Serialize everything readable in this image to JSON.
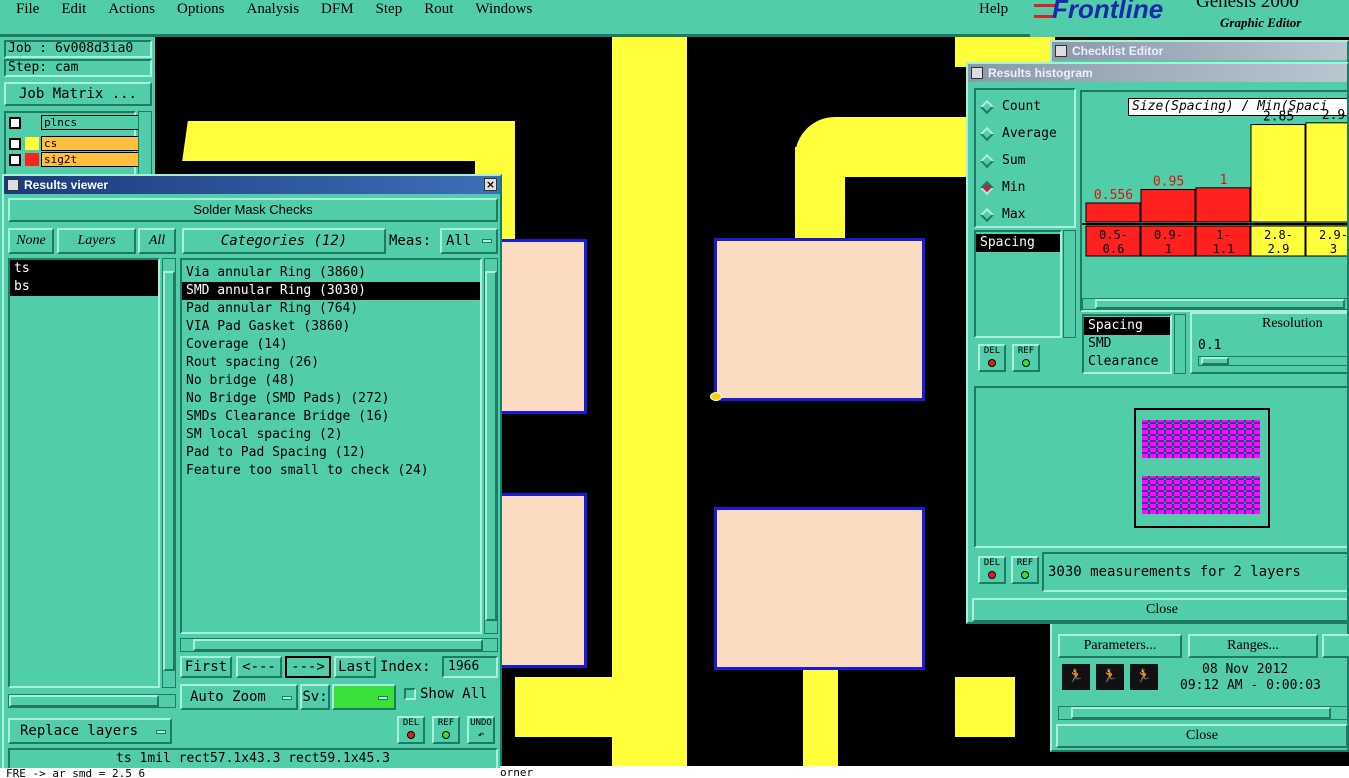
{
  "menubar": {
    "items": [
      "File",
      "Edit",
      "Actions",
      "Options",
      "Analysis",
      "DFM",
      "Step",
      "Rout",
      "Windows"
    ],
    "help": "Help"
  },
  "brand": {
    "logo": "Frontline",
    "product": "Genesis 2000",
    "subtitle": "Graphic Editor"
  },
  "job_panel": {
    "job": "Job : 6v008d3ia0",
    "step": "Step: cam",
    "job_matrix": "Job Matrix ...",
    "layers": [
      "plncs",
      "cs",
      "sig2t"
    ]
  },
  "results_viewer": {
    "title": "Results viewer",
    "heading": "Solder Mask Checks",
    "none_btn": "None",
    "layers_btn": "Layers",
    "all_btn": "All",
    "layer_list": [
      "ts",
      "bs"
    ],
    "categories_label": "Categories (12)",
    "meas_label": "Meas:",
    "meas_value": "All",
    "categories": [
      "Via annular Ring (3860)",
      "SMD annular Ring (3030)",
      "Pad annular Ring (764)",
      "VIA Pad Gasket (3860)",
      "Coverage (14)",
      "Rout spacing (26)",
      "No bridge (48)",
      "No Bridge (SMD Pads) (272)",
      "SMDs Clearance Bridge (16)",
      "SM local spacing (2)",
      "Pad to Pad Spacing (12)",
      "Feature too small to check (24)"
    ],
    "selected_index": 1,
    "first": "First",
    "prev": "<---",
    "next": "--->",
    "last": "Last",
    "index_label": "Index:",
    "index_value": "1966",
    "auto_zoom": "Auto Zoom",
    "sv_label": "Sv:",
    "show_all": "Show All",
    "replace_layers": "Replace layers",
    "del": "DEL",
    "ref": "REF",
    "undo": "UNDO",
    "status": "ts 1mil  rect57.1x43.3  rect59.1x45.3"
  },
  "command_line": "FRE -> ar_smd = 2.5 6",
  "canvas_footer": "orner",
  "checklist_editor": {
    "title": "Checklist Editor",
    "parameters": "Parameters...",
    "ranges": "Ranges...",
    "date": "08 Nov 2012",
    "time": "09:12 AM - 0:00:03",
    "close": "Close"
  },
  "histogram": {
    "title": "Results histogram",
    "modes": [
      "Count",
      "Average",
      "Sum",
      "Min",
      "Max"
    ],
    "selected_mode": "Min",
    "attr_list": [
      "Spacing"
    ],
    "chart_title": "Size(Spacing) / Min(Spaci",
    "bars": [
      {
        "label": "0.5-0.6",
        "value": 0.556,
        "value_label": "0.556",
        "color": "#ff2020"
      },
      {
        "label": "0.9-1",
        "value": 0.95,
        "value_label": "0.95",
        "color": "#ff2020"
      },
      {
        "label": "1-1.1",
        "value": 1,
        "value_label": "1",
        "color": "#ff2020"
      },
      {
        "label": "2.8-2.9",
        "value": 2.85,
        "value_label": "2.85",
        "color": "#ffff3c"
      },
      {
        "label": "2.9-3",
        "value": 2.9,
        "value_label": "2.9",
        "color": "#ffff3c"
      }
    ],
    "group_list": [
      "Spacing",
      "SMD",
      "Clearance"
    ],
    "resolution_label": "Resolution",
    "resolution_value": "0.1",
    "summary": "3030 measurements for 2 layers",
    "close": "Close",
    "del": "DEL",
    "ref": "REF"
  },
  "chart_data": {
    "type": "bar",
    "title": "Size(Spacing) / Min(Spaci",
    "categories": [
      "0.5-0.6",
      "0.9-1",
      "1-1.1",
      "2.8-2.9",
      "2.9-3"
    ],
    "values": [
      0.556,
      0.95,
      1,
      2.85,
      2.9
    ]
  }
}
